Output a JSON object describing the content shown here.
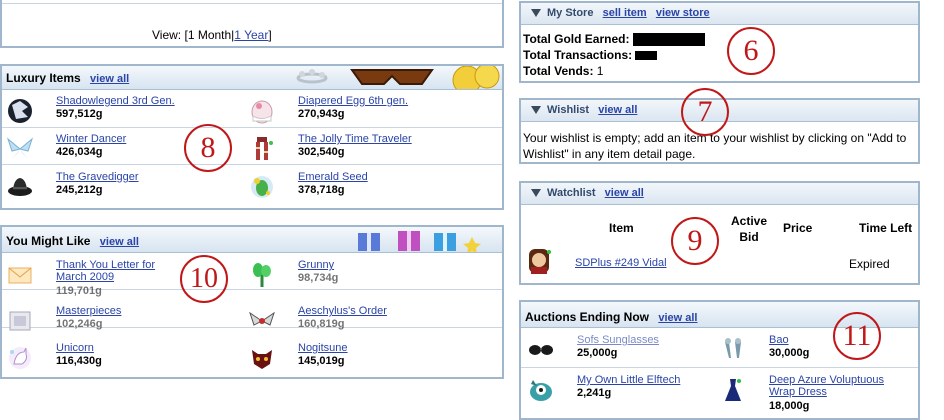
{
  "top_panel": {
    "view_label": "View:",
    "option_1_month": "[1 Month|",
    "option_1_year": "1 Year",
    "close_bracket": "]"
  },
  "luxury": {
    "title": "Luxury Items",
    "view_all": "view all",
    "annotation": "8",
    "items": [
      {
        "name": "Shadowlegend 3rd Gen.",
        "price": "597,512g",
        "icon": "shadow-creature-icon"
      },
      {
        "name": "Diapered Egg 6th gen.",
        "price": "270,943g",
        "icon": "egg-icon"
      },
      {
        "name": "Winter Dancer",
        "price": "426,034g",
        "icon": "wings-icon"
      },
      {
        "name": "The Jolly Time Traveler",
        "price": "302,540g",
        "icon": "scarf-icon"
      },
      {
        "name": "The Gravedigger",
        "price": "245,212g",
        "icon": "hat-icon"
      },
      {
        "name": "Emerald Seed",
        "price": "378,718g",
        "icon": "seed-icon"
      }
    ]
  },
  "might_like": {
    "title": "You Might Like",
    "view_all": "view all",
    "annotation": "10",
    "items": [
      {
        "name": "Thank You Letter for March 2009",
        "price": "119,701g",
        "icon": "letter-icon"
      },
      {
        "name": "Grunny",
        "price": "98,734g",
        "icon": "plant-icon"
      },
      {
        "name": "Masterpieces",
        "price": "102,246g",
        "icon": "frame-icon"
      },
      {
        "name": "Aeschylus's Order",
        "price": "160,819g",
        "icon": "wings-icon"
      },
      {
        "name": "Unicorn",
        "price": "116,430g",
        "icon": "unicorn-icon"
      },
      {
        "name": "Nogitsune",
        "price": "145,019g",
        "icon": "mask-icon"
      }
    ]
  },
  "my_store": {
    "title": "My Store",
    "sell_item": "sell item",
    "view_store": "view store",
    "annotation": "6",
    "total_gold_label": "Total Gold Earned:",
    "total_transactions_label": "Total Transactions:",
    "total_vends_label": "Total Vends:",
    "total_vends_value": "1"
  },
  "wishlist": {
    "title": "Wishlist",
    "view_all": "view all",
    "annotation": "7",
    "message": "Your wishlist is empty; add an item to your wishlist by clicking on \"Add to Wishlist\" in any item detail page."
  },
  "watchlist": {
    "title": "Watchlist",
    "view_all": "view all",
    "annotation": "9",
    "col_item": "Item",
    "col_active_bid": "Active Bid",
    "col_price": "Price",
    "col_time_left": "Time Left",
    "rows": [
      {
        "name": "SDPlus #249 Vidal",
        "active_bid": "",
        "price": "",
        "time_left": "Expired",
        "icon": "avatar-icon"
      }
    ]
  },
  "auctions": {
    "title": "Auctions Ending Now",
    "view_all": "view all",
    "annotation": "11",
    "items": [
      {
        "name": "Sofs Sunglasses",
        "price": "25,000g",
        "icon": "sunglasses-icon"
      },
      {
        "name": "Bao",
        "price": "30,000g",
        "icon": "bao-icon"
      },
      {
        "name": "My Own Little Elftech",
        "price": "2,241g",
        "icon": "elftech-icon"
      },
      {
        "name": "Deep Azure Voluptuous Wrap Dress",
        "price": "18,000g",
        "icon": "dress-icon"
      }
    ]
  }
}
